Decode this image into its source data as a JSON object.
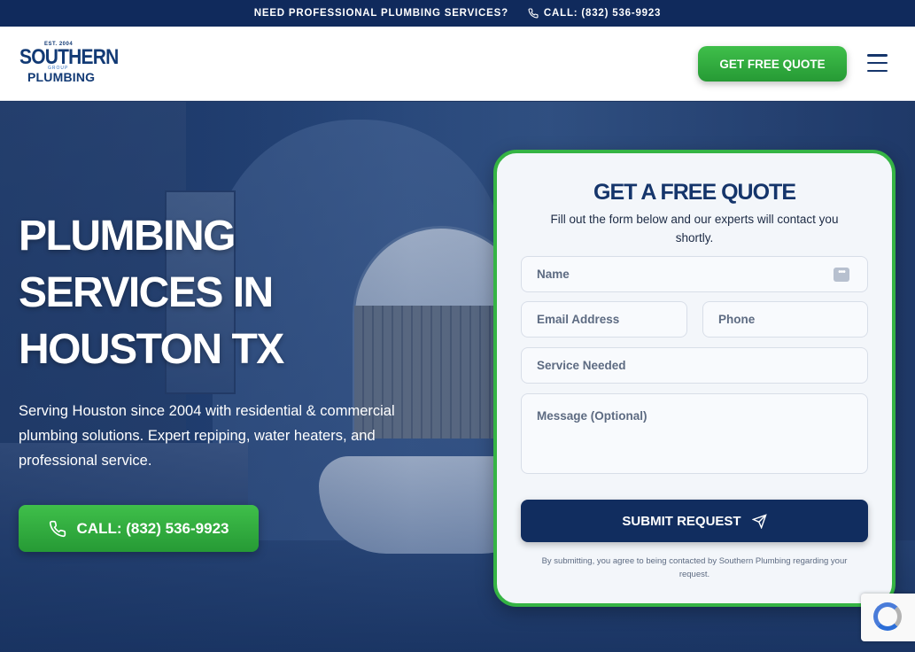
{
  "topbar": {
    "tagline": "NEED PROFESSIONAL PLUMBING SERVICES?",
    "call_label": "CALL: (832) 536-9923",
    "phone_icon": "phone-icon"
  },
  "header": {
    "logo": {
      "est": "EST. 2004",
      "word1": "SOUTHERN",
      "word2": "PLUMBING",
      "word3": "GROUP"
    },
    "quote_button": "GET FREE QUOTE",
    "menu_icon": "hamburger-menu-icon"
  },
  "hero": {
    "title_line1": "PLUMBING",
    "title_line2": "SERVICES IN",
    "title_line3": "HOUSTON TX",
    "subtitle": "Serving Houston since 2004 with residential & commercial plumbing solutions. Expert repiping, water heaters, and professional service.",
    "call_button": "CALL: (832) 536-9923"
  },
  "form": {
    "title": "GET A FREE QUOTE",
    "description": "Fill out the form below and our experts will contact you shortly.",
    "name_placeholder": "Name",
    "email_placeholder": "Email Address",
    "phone_placeholder": "Phone",
    "service_placeholder": "Service Needed",
    "message_placeholder": "Message (Optional)",
    "submit_label": "SUBMIT REQUEST",
    "fineprint": "By submitting, you agree to being contacted by Southern Plumbing regarding your request."
  },
  "colors": {
    "navy": "#102a5c",
    "green": "#35b444",
    "card_bg": "#f3f6fa"
  }
}
